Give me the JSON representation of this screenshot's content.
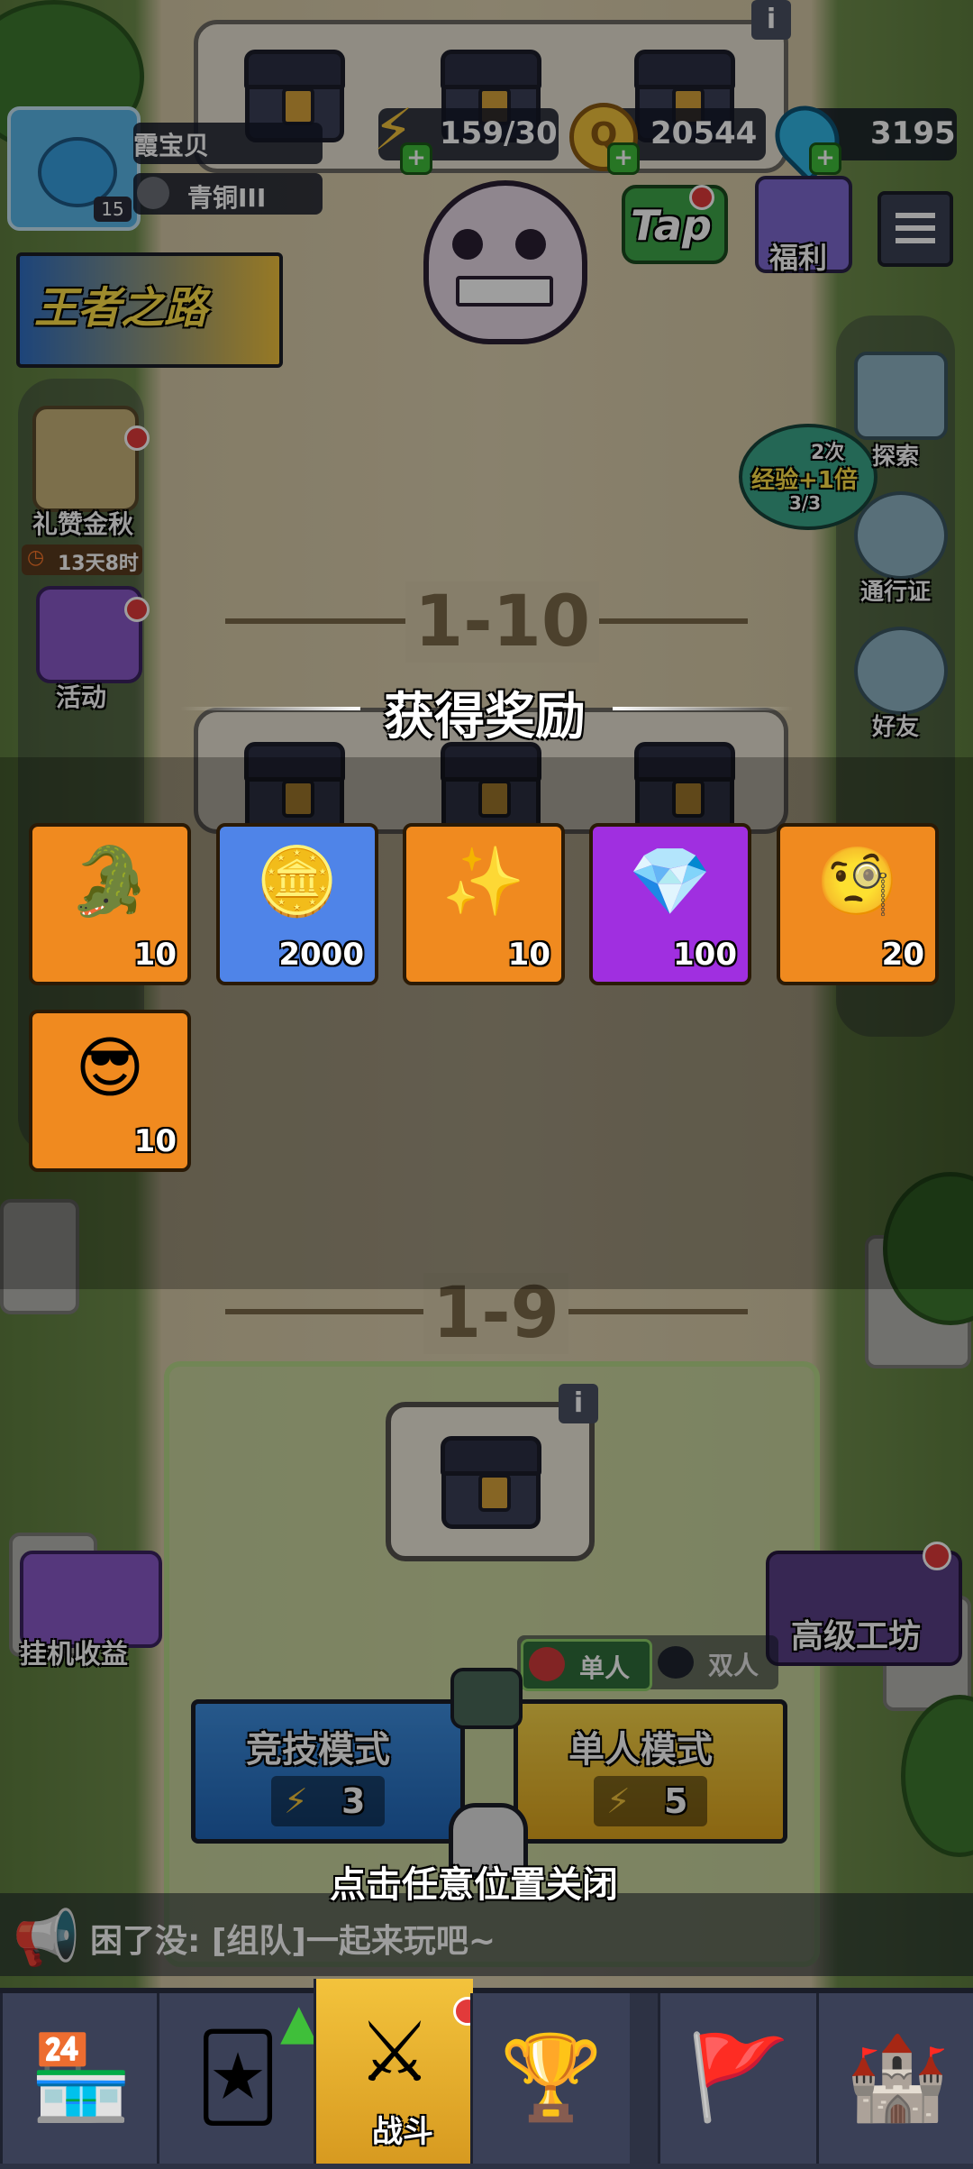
{
  "resources": {
    "energy": "159/30",
    "gold": "20544",
    "gems": "3195"
  },
  "player": {
    "name": "霞宝贝",
    "level": "15",
    "rank": "青铜III"
  },
  "top_right": {
    "tap_label": "Tap",
    "welfare_label": "福利"
  },
  "left_side": {
    "banner_label": "王者之路",
    "event1_label": "礼赞金秋",
    "event1_timer": "13天8时",
    "event2_label": "活动",
    "idle_label": "挂机收益"
  },
  "right_side": {
    "exp_times": "2次",
    "exp_label": "经验+1倍",
    "exp_count": "3/3",
    "explore_label": "探索",
    "pass_label": "通行证",
    "friends_label": "好友",
    "workshop_label": "高级工坊"
  },
  "stages": {
    "stage_top": "1-10",
    "stage_mid": "1-9"
  },
  "reward_popup": {
    "title": "获得奖励",
    "items": [
      {
        "icon": "crocodile-puzzle-icon",
        "count": "10",
        "color": "#f08a1f"
      },
      {
        "icon": "gold-coins-icon",
        "count": "2000",
        "color": "#4f84e8"
      },
      {
        "icon": "gold-nuggets-icon",
        "count": "10",
        "color": "#f08a1f"
      },
      {
        "icon": "blue-gems-icon",
        "count": "100",
        "color": "#a02fe0"
      },
      {
        "icon": "scholar-puzzle-icon",
        "count": "20",
        "color": "#f08a1f"
      },
      {
        "icon": "sunglasses-puzzle-icon",
        "count": "10",
        "color": "#f08a1f"
      }
    ],
    "close_hint": "点击任意位置关闭"
  },
  "battle": {
    "single_toggle": "单人",
    "duo_toggle": "双人",
    "arena_mode": "竞技模式",
    "arena_cost": "3",
    "solo_mode": "单人模式",
    "solo_cost": "5"
  },
  "chat": {
    "message": "困了没: [组队]一起来玩吧~"
  },
  "nav": {
    "battle_label": "战斗"
  }
}
